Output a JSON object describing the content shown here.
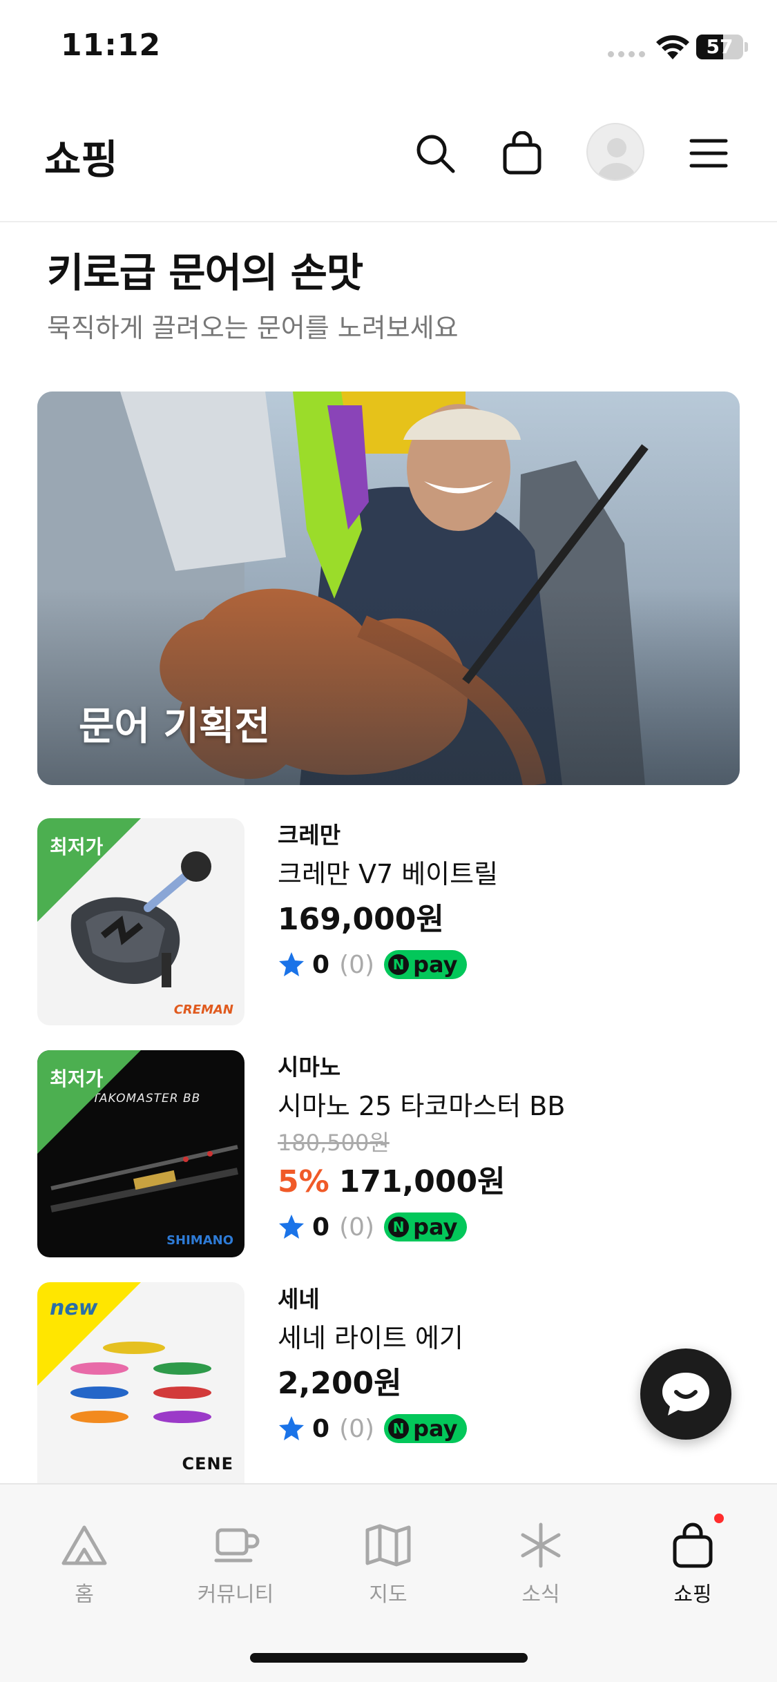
{
  "status_bar": {
    "time": "11:12",
    "battery_text": "57",
    "battery_level": 57
  },
  "header": {
    "title": "쇼핑",
    "icons": [
      "search-icon",
      "shopping-bag-icon",
      "avatar",
      "menu-icon"
    ]
  },
  "section": {
    "title": "키로급 문어의 손맛",
    "subtitle": "묵직하게 끌려오는 문어를 노려보세요"
  },
  "banner": {
    "label": "문어 기획전"
  },
  "products": [
    {
      "badge": "최저가",
      "badge_color": "#4caf50",
      "logo_text": "CREMAN",
      "brand": "크레만",
      "name": "크레만 V7 베이트릴",
      "original_price": "",
      "discount": "",
      "price": "169,000원",
      "rating": "0",
      "review_count": "(0)",
      "pay": "pay"
    },
    {
      "badge": "최저가",
      "badge_color": "#4caf50",
      "logo_text": "SHIMANO",
      "thumb_text": "TAKOMASTER BB",
      "brand": "시마노",
      "name": "시마노 25 타코마스터 BB",
      "original_price": "180,500원",
      "discount": "5%",
      "price": "171,000원",
      "rating": "0",
      "review_count": "(0)",
      "pay": "pay"
    },
    {
      "badge": "new",
      "badge_color": "#ffe600",
      "logo_text": "CENE",
      "brand": "세네",
      "name": "세네 라이트 에기",
      "original_price": "",
      "discount": "",
      "price": "2,200원",
      "rating": "0",
      "review_count": "(0)",
      "pay": "pay"
    }
  ],
  "bottom_nav": {
    "items": [
      {
        "label": "홈",
        "icon": "tent-icon"
      },
      {
        "label": "커뮤니티",
        "icon": "cup-icon"
      },
      {
        "label": "지도",
        "icon": "map-icon"
      },
      {
        "label": "소식",
        "icon": "asterisk-icon"
      },
      {
        "label": "쇼핑",
        "icon": "shopping-bag-icon",
        "active": true
      }
    ]
  },
  "colors": {
    "accent_discount": "#f05a28",
    "npay_green": "#03c75a",
    "star_blue": "#1a73e8",
    "notification_red": "#ff2d2d"
  }
}
